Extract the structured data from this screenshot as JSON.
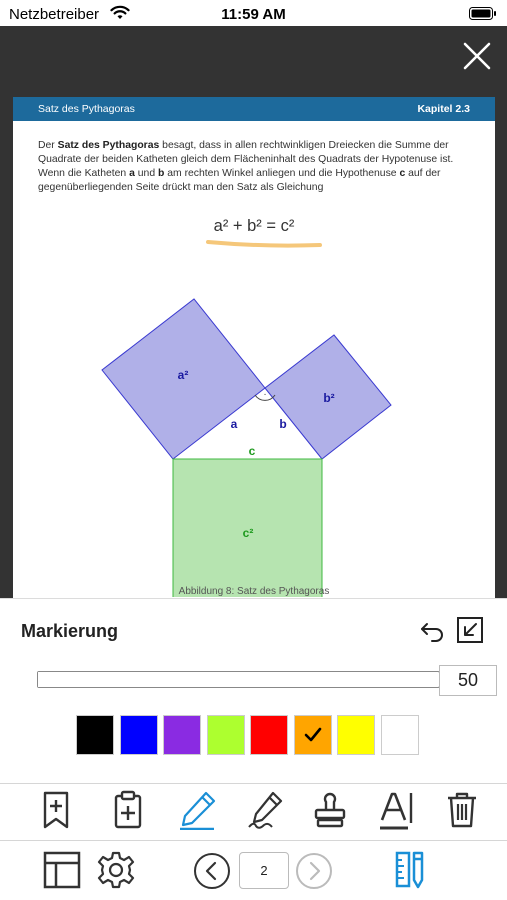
{
  "status_bar": {
    "carrier": "Netzbetreiber",
    "time": "11:59 AM",
    "wifi_icon": "wifi-icon",
    "battery_icon": "battery-icon"
  },
  "viewer": {
    "close_icon": "close-icon"
  },
  "document": {
    "header_title": "Satz des Pythagoras",
    "header_chapter": "Kapitel 2.3",
    "para_seg1": "Der ",
    "para_bold1": "Satz des Pythagoras",
    "para_seg2": " besagt, dass in allen rechtwinkligen Dreiecken die Summe der Quadrate der beiden Katheten gleich dem Flächeninhalt des Quadrats der Hypotenuse ist. Wenn die Katheten ",
    "para_bold2": "a",
    "para_seg3": " und ",
    "para_bold3": "b",
    "para_seg4": " am rechten Winkel anliegen und die Hypothenuse ",
    "para_bold4": "c",
    "para_seg5": " auf der gegenüberliegenden Seite drückt man den Satz als Gleichung",
    "formula": "a² + b² = c²",
    "highlight_color": "#f5c77a",
    "figure": {
      "square_a_label": "a²",
      "square_b_label": "b²",
      "square_c_label": "c²",
      "side_a_label": "a",
      "side_b_label": "b",
      "side_c_label": "c",
      "right_angle_mark": "·",
      "square_ab_fill": "#b0b0e8",
      "square_ab_stroke": "#3a3ad0",
      "square_c_fill": "#b6e4b0",
      "square_c_stroke": "#3fb83f"
    },
    "caption": "Abbildung 8: Satz des Pythagoras"
  },
  "markup_panel": {
    "title": "Markierung",
    "undo_icon": "undo-icon",
    "collapse_icon": "collapse-icon",
    "stroke_size": "50",
    "stroke_size_fraction": 0.5,
    "colors": [
      {
        "hex": "#000000",
        "selected": false
      },
      {
        "hex": "#0000ff",
        "selected": false
      },
      {
        "hex": "#8a2be2",
        "selected": false
      },
      {
        "hex": "#adff2f",
        "selected": false
      },
      {
        "hex": "#ff0000",
        "selected": false
      },
      {
        "hex": "#ffa500",
        "selected": true
      },
      {
        "hex": "#ffff00",
        "selected": false
      },
      {
        "hex": "#ffffff",
        "selected": false
      }
    ]
  },
  "toolbar_tools": [
    {
      "icon": "bookmark-add-icon",
      "active": false
    },
    {
      "icon": "clipboard-add-icon",
      "active": false
    },
    {
      "icon": "highlighter-pen-icon",
      "active": true
    },
    {
      "icon": "signature-pen-icon",
      "active": false
    },
    {
      "icon": "stamp-icon",
      "active": false
    },
    {
      "icon": "text-cursor-icon",
      "active": false
    },
    {
      "icon": "trash-icon",
      "active": false
    }
  ],
  "toolbar_nav": {
    "page_number": "2",
    "layout_icon": "layout-icon",
    "settings_icon": "gear-icon",
    "prev_icon": "chevron-left-icon",
    "next_icon": "chevron-right-icon",
    "ruler_icon": "ruler-pencil-icon"
  },
  "colors": {
    "accent": "#1a8fd6",
    "header_blue": "#1d6a9c",
    "icon_dark": "#333333",
    "disabled": "#bbbbbb"
  }
}
